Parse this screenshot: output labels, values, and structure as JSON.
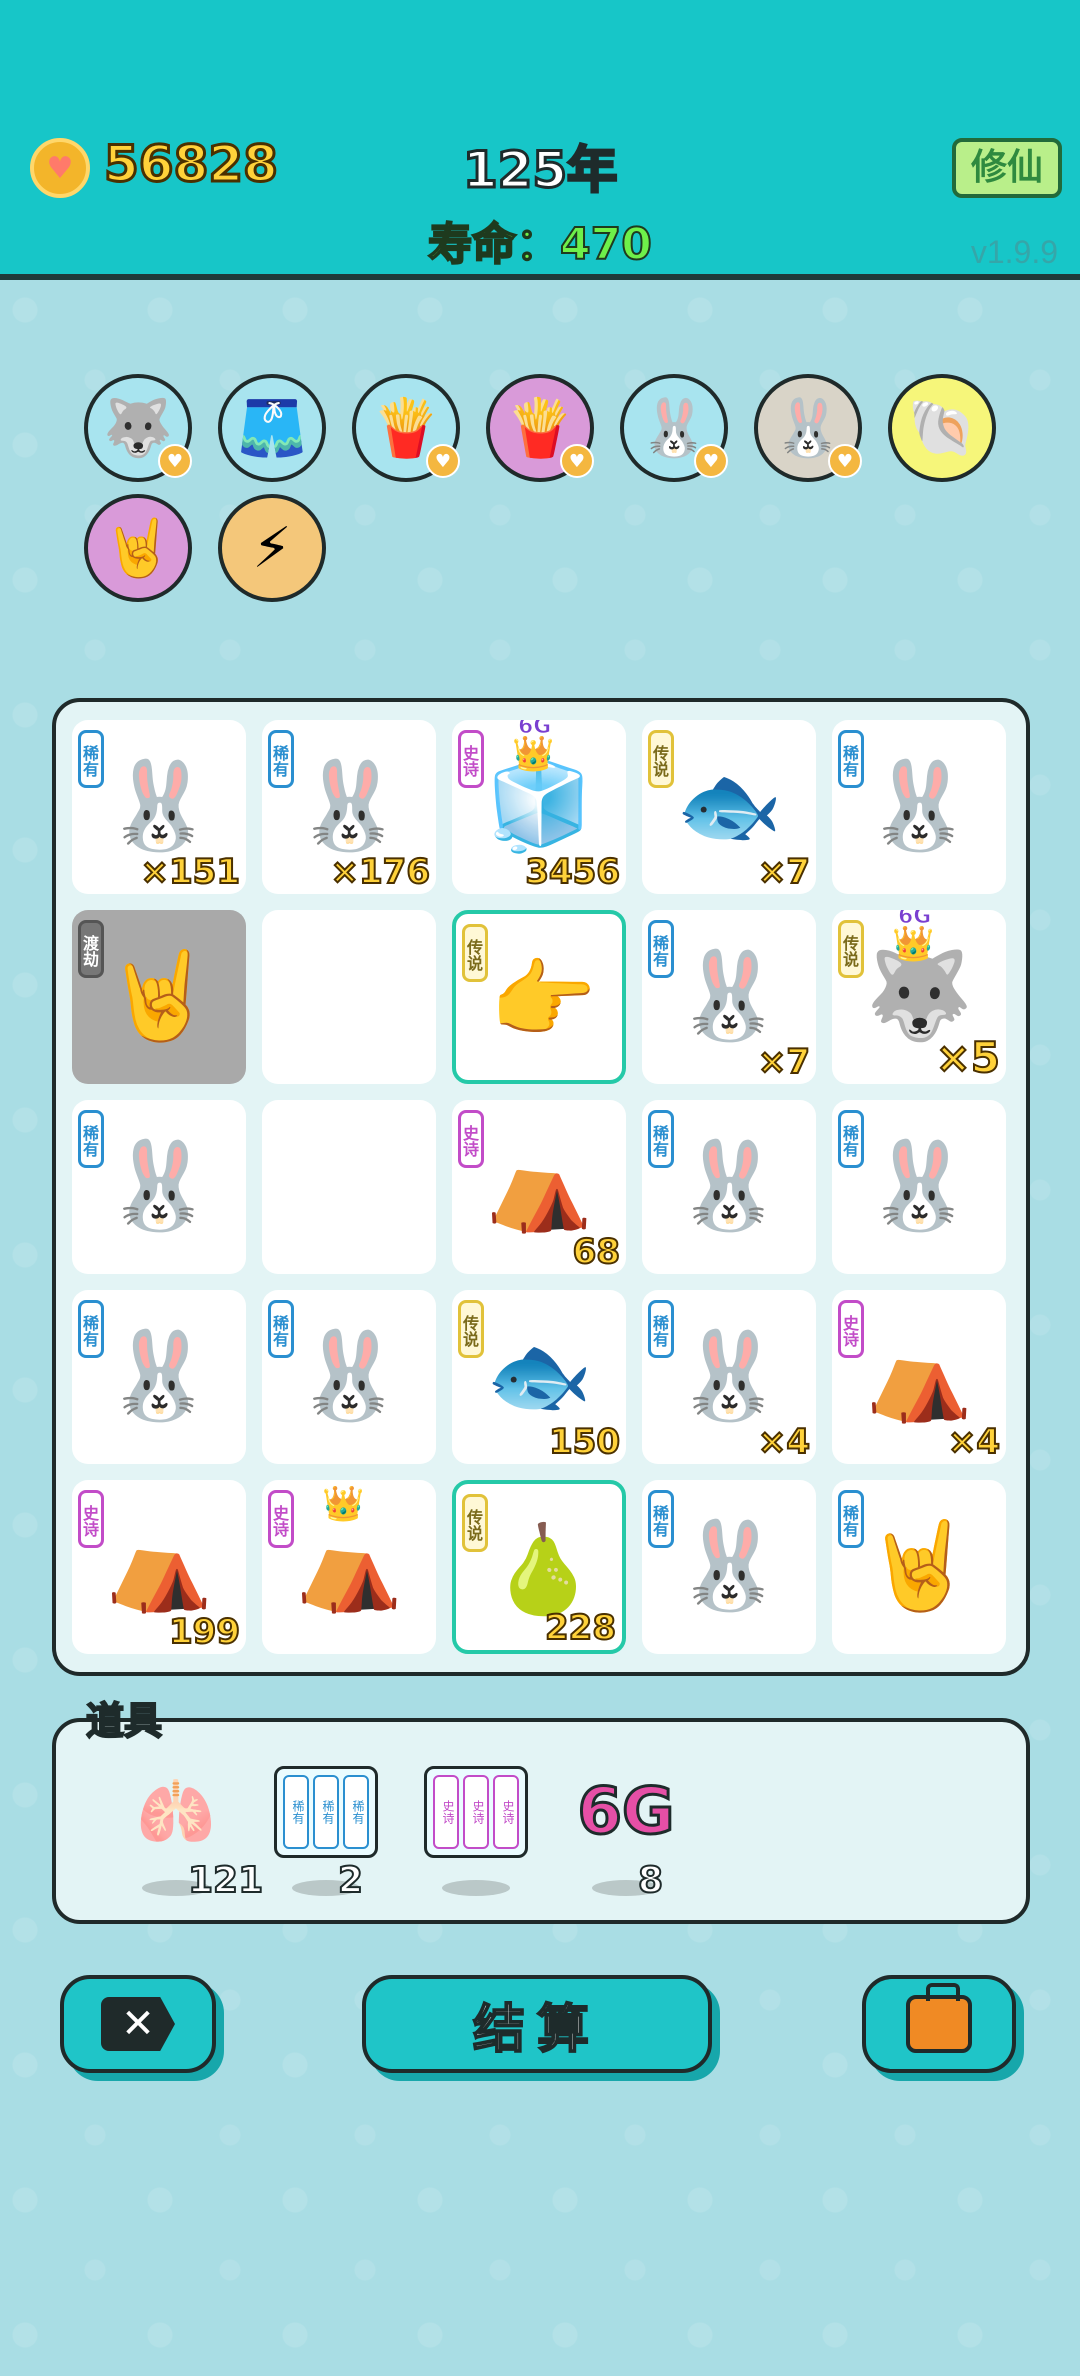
{
  "header": {
    "coins": "56828",
    "year": "125年",
    "life_label": "寿命：470",
    "mode_button": "修仙",
    "version": "v1.9.9"
  },
  "badges": [
    {
      "icon": "husky-icon",
      "bg": "#a8e4ef",
      "glyph": "🐺",
      "heart": true
    },
    {
      "icon": "skirt-icon",
      "bg": "#a8e4ef",
      "glyph": "🩳",
      "heart": false
    },
    {
      "icon": "fries-icon",
      "bg": "#a8e4ef",
      "glyph": "🍟",
      "heart": true
    },
    {
      "icon": "fries-icon",
      "bg": "#d99ad9",
      "glyph": "🍟",
      "heart": true
    },
    {
      "icon": "rabbit-icon",
      "bg": "#a8e4ef",
      "glyph": "🐰",
      "heart": true
    },
    {
      "icon": "rabbit-icon",
      "bg": "#d9d4c8",
      "glyph": "🐰",
      "heart": true
    },
    {
      "icon": "shell-icon",
      "bg": "#f6f67a",
      "glyph": "🐚",
      "heart": false
    },
    {
      "icon": "rock-hand-icon",
      "bg": "#d99ad9",
      "glyph": "🤘",
      "heart": false
    },
    {
      "icon": "lightning-icon",
      "bg": "#f4c77a",
      "glyph": "⚡",
      "heart": false
    }
  ],
  "tags": {
    "rare": "稀有",
    "epic": "史诗",
    "legend": "传说",
    "tribulation": "渡劫"
  },
  "board": [
    {
      "tag": "rare",
      "glyph": "🐰",
      "count": "×151",
      "name": "rabbit"
    },
    {
      "tag": "rare",
      "glyph": "🐰",
      "count": "×176",
      "name": "rabbit"
    },
    {
      "tag": "epic",
      "glyph": "🧊",
      "count": "3456",
      "name": "ice-block",
      "crown": true,
      "sixg": "6G"
    },
    {
      "tag": "legend",
      "glyph": "🐟",
      "count": "×7",
      "name": "koi-fish"
    },
    {
      "tag": "rare",
      "glyph": "🐰",
      "count": "",
      "name": "rabbit"
    },
    {
      "tag": "tribulation",
      "glyph": "🤘",
      "count": "",
      "name": "rock-hand",
      "gray": true
    },
    {
      "tag": "",
      "glyph": "",
      "count": "",
      "name": "empty"
    },
    {
      "tag": "legend",
      "glyph": "👉",
      "count": "",
      "name": "pointing-hand",
      "selected": true
    },
    {
      "tag": "rare",
      "glyph": "🐰",
      "count": "×7",
      "name": "rabbit"
    },
    {
      "tag": "legend",
      "glyph": "🐺",
      "count": "×5",
      "name": "husky",
      "crown": true,
      "sixg": "6G",
      "big": true
    },
    {
      "tag": "rare",
      "glyph": "🐰",
      "count": "",
      "name": "rabbit"
    },
    {
      "tag": "",
      "glyph": "",
      "count": "",
      "name": "empty"
    },
    {
      "tag": "epic",
      "glyph": "⛺",
      "count": "68",
      "name": "tent"
    },
    {
      "tag": "rare",
      "glyph": "🐰",
      "count": "",
      "name": "rabbit"
    },
    {
      "tag": "rare",
      "glyph": "🐰",
      "count": "",
      "name": "rabbit"
    },
    {
      "tag": "rare",
      "glyph": "🐰",
      "count": "",
      "name": "rabbit"
    },
    {
      "tag": "rare",
      "glyph": "🐰",
      "count": "",
      "name": "rabbit"
    },
    {
      "tag": "legend",
      "glyph": "🐟",
      "count": "150",
      "name": "koi-fish"
    },
    {
      "tag": "rare",
      "glyph": "🐰",
      "count": "×4",
      "name": "rabbit"
    },
    {
      "tag": "epic",
      "glyph": "⛺",
      "count": "×4",
      "name": "tent"
    },
    {
      "tag": "epic",
      "glyph": "⛺",
      "count": "199",
      "name": "tent"
    },
    {
      "tag": "epic",
      "glyph": "⛺",
      "count": "",
      "name": "tent",
      "crown": true
    },
    {
      "tag": "legend",
      "glyph": "🍐",
      "count": "228",
      "name": "pear",
      "selected": true
    },
    {
      "tag": "rare",
      "glyph": "🐰",
      "count": "",
      "name": "rabbit"
    },
    {
      "tag": "rare",
      "glyph": "🤘",
      "count": "",
      "name": "rock-hand"
    }
  ],
  "props": {
    "title": "道具",
    "items": [
      {
        "name": "liver-prop",
        "glyph": "🫁",
        "count": "121"
      },
      {
        "name": "rare-rack-prop",
        "count": "2",
        "slots": [
          "稀有",
          "稀有",
          "稀有"
        ],
        "kind": "rare"
      },
      {
        "name": "epic-rack-prop",
        "count": "",
        "slots": [
          "史诗",
          "史诗",
          "史诗"
        ],
        "kind": "epic"
      },
      {
        "name": "6g-prop",
        "text": "6G",
        "count": "8"
      }
    ]
  },
  "buttons": {
    "close": "✕",
    "settle": "结算",
    "bag": "bag"
  }
}
